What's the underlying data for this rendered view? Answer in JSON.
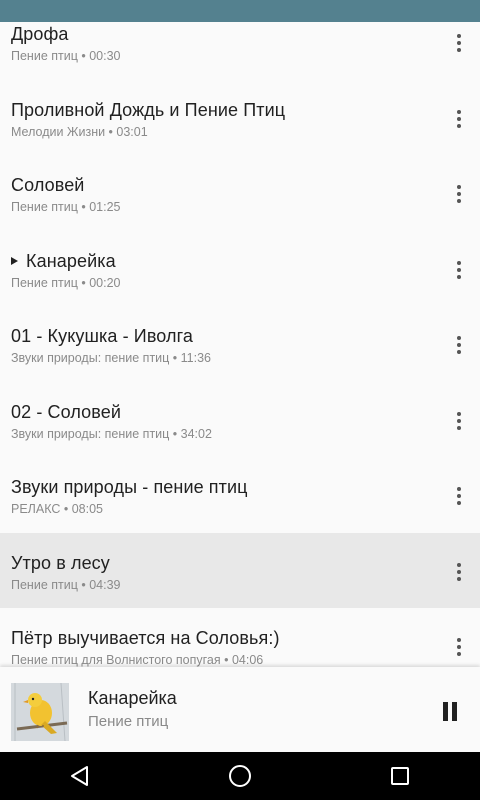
{
  "tracks": [
    {
      "title": "Дрофа",
      "subtitle": "Пение птиц • 00:30",
      "playing": false,
      "selected": false
    },
    {
      "title": "Проливной Дождь и Пение Птиц",
      "subtitle": "Мелодии Жизни • 03:01",
      "playing": false,
      "selected": false
    },
    {
      "title": "Соловей",
      "subtitle": "Пение птиц • 01:25",
      "playing": false,
      "selected": false
    },
    {
      "title": "Канарейка",
      "subtitle": "Пение птиц • 00:20",
      "playing": true,
      "selected": false
    },
    {
      "title": "01 - Кукушка - Иволга",
      "subtitle": "Звуки природы: пение птиц • 11:36",
      "playing": false,
      "selected": false
    },
    {
      "title": "02 - Соловей",
      "subtitle": "Звуки природы: пение птиц • 34:02",
      "playing": false,
      "selected": false
    },
    {
      "title": "Звуки природы - пение птиц",
      "subtitle": "РЕЛАКС • 08:05",
      "playing": false,
      "selected": false
    },
    {
      "title": "Утро в лесу",
      "subtitle": "Пение птиц • 04:39",
      "playing": false,
      "selected": true
    },
    {
      "title": "Пётр выучивается на Соловья:)",
      "subtitle": "Пение птиц для Волнистого попугая • 04:06",
      "playing": false,
      "selected": false
    }
  ],
  "now_playing": {
    "title": "Канарейка",
    "subtitle": "Пение птиц",
    "artwork": "canary-bird-image",
    "control_icon": "pause-icon"
  },
  "nav": {
    "icons": [
      "back-icon",
      "home-icon",
      "recents-icon"
    ]
  },
  "colors": {
    "status_bar": "#54818f",
    "selected_row": "#e8e8e8",
    "background": "#fafafa"
  }
}
